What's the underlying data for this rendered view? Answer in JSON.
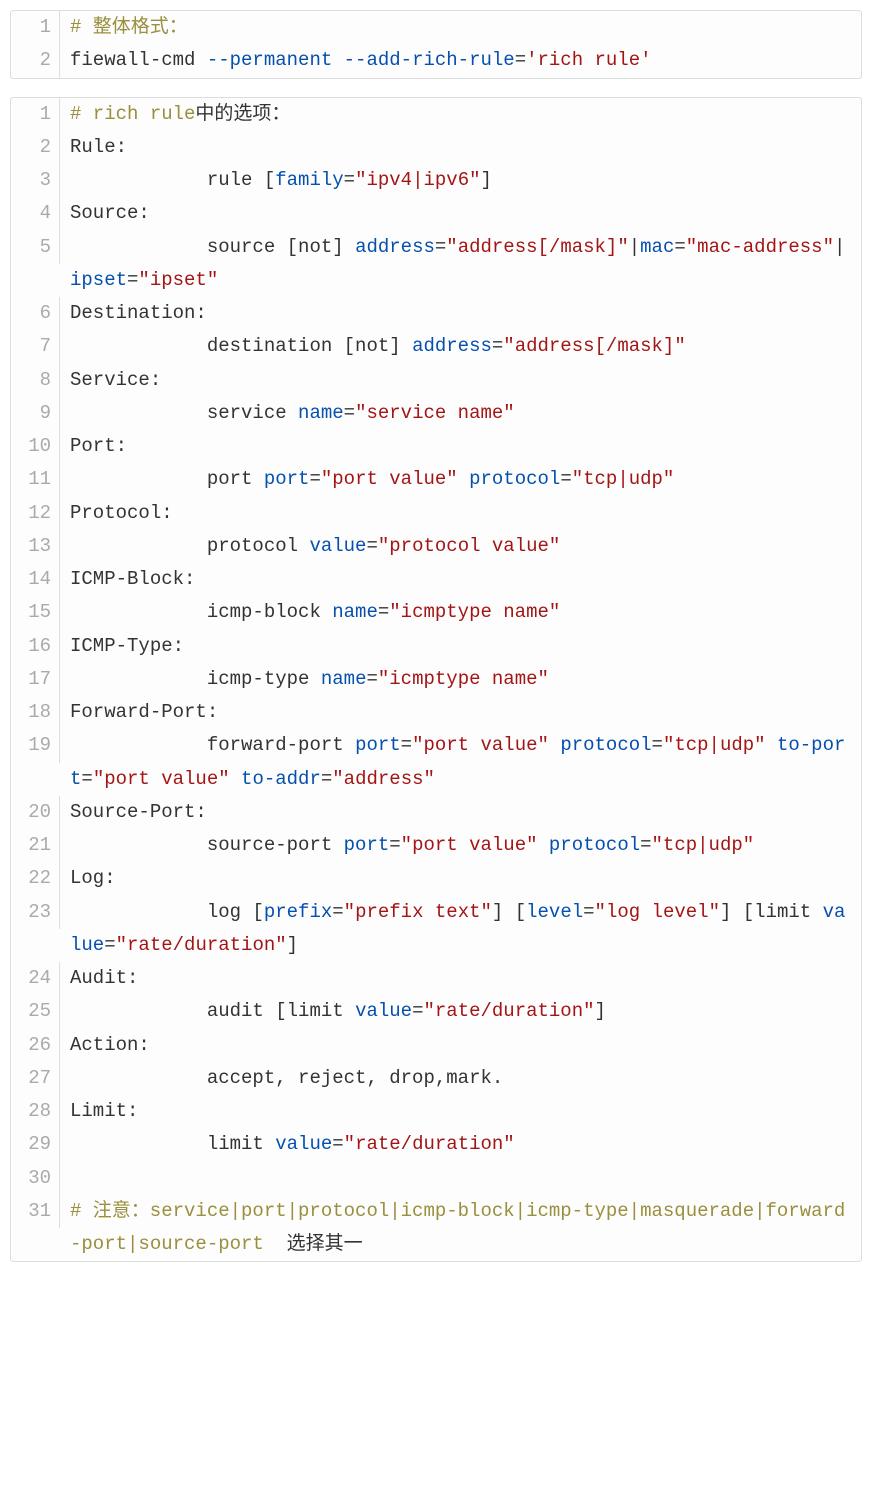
{
  "block1": {
    "lines": [
      {
        "n": "1",
        "seg": [
          {
            "cls": "c",
            "t": "# 整体格式："
          }
        ]
      },
      {
        "n": "2",
        "seg": [
          {
            "cls": "t",
            "t": "fiewall-cmd "
          },
          {
            "cls": "k",
            "t": "--permanent"
          },
          {
            "cls": "t",
            "t": " "
          },
          {
            "cls": "k",
            "t": "--add-rich-rule"
          },
          {
            "cls": "t",
            "t": "="
          },
          {
            "cls": "s",
            "t": "'rich rule'"
          }
        ]
      }
    ]
  },
  "block2": {
    "lines": [
      {
        "n": "1",
        "seg": [
          {
            "cls": "c",
            "t": "# rich rule"
          },
          {
            "cls": "t",
            "t": "中的选项："
          }
        ]
      },
      {
        "n": "2",
        "seg": [
          {
            "cls": "t",
            "t": "Rule:"
          }
        ]
      },
      {
        "n": "3",
        "seg": [
          {
            "cls": "t",
            "t": "            rule ["
          },
          {
            "cls": "k",
            "t": "family"
          },
          {
            "cls": "t",
            "t": "="
          },
          {
            "cls": "s",
            "t": "\"ipv4|ipv6\""
          },
          {
            "cls": "t",
            "t": "]"
          }
        ]
      },
      {
        "n": "4",
        "seg": [
          {
            "cls": "t",
            "t": "Source:"
          }
        ]
      },
      {
        "n": "5",
        "seg": [
          {
            "cls": "t",
            "t": "            source [not] "
          },
          {
            "cls": "k",
            "t": "address"
          },
          {
            "cls": "t",
            "t": "="
          },
          {
            "cls": "s",
            "t": "\"address[/mask]\""
          },
          {
            "cls": "t",
            "t": "|"
          },
          {
            "cls": "k",
            "t": "mac"
          },
          {
            "cls": "t",
            "t": "="
          },
          {
            "cls": "s",
            "t": "\"mac-address\""
          },
          {
            "cls": "t",
            "t": "|"
          },
          {
            "cls": "k",
            "t": "ipset"
          },
          {
            "cls": "t",
            "t": "="
          },
          {
            "cls": "s",
            "t": "\"ipset\""
          }
        ]
      },
      {
        "n": "6",
        "seg": [
          {
            "cls": "t",
            "t": "Destination:"
          }
        ]
      },
      {
        "n": "7",
        "seg": [
          {
            "cls": "t",
            "t": "            destination [not] "
          },
          {
            "cls": "k",
            "t": "address"
          },
          {
            "cls": "t",
            "t": "="
          },
          {
            "cls": "s",
            "t": "\"address[/mask]\""
          }
        ]
      },
      {
        "n": "8",
        "seg": [
          {
            "cls": "t",
            "t": "Service:"
          }
        ]
      },
      {
        "n": "9",
        "seg": [
          {
            "cls": "t",
            "t": "            service "
          },
          {
            "cls": "k",
            "t": "name"
          },
          {
            "cls": "t",
            "t": "="
          },
          {
            "cls": "s",
            "t": "\"service name\""
          }
        ]
      },
      {
        "n": "10",
        "seg": [
          {
            "cls": "t",
            "t": "Port:"
          }
        ]
      },
      {
        "n": "11",
        "seg": [
          {
            "cls": "t",
            "t": "            port "
          },
          {
            "cls": "k",
            "t": "port"
          },
          {
            "cls": "t",
            "t": "="
          },
          {
            "cls": "s",
            "t": "\"port value\""
          },
          {
            "cls": "t",
            "t": " "
          },
          {
            "cls": "k",
            "t": "protocol"
          },
          {
            "cls": "t",
            "t": "="
          },
          {
            "cls": "s",
            "t": "\"tcp|udp\""
          }
        ]
      },
      {
        "n": "12",
        "seg": [
          {
            "cls": "t",
            "t": "Protocol:"
          }
        ]
      },
      {
        "n": "13",
        "seg": [
          {
            "cls": "t",
            "t": "            protocol "
          },
          {
            "cls": "k",
            "t": "value"
          },
          {
            "cls": "t",
            "t": "="
          },
          {
            "cls": "s",
            "t": "\"protocol value\""
          }
        ]
      },
      {
        "n": "14",
        "seg": [
          {
            "cls": "t",
            "t": "ICMP-Block:"
          }
        ]
      },
      {
        "n": "15",
        "seg": [
          {
            "cls": "t",
            "t": "            icmp-block "
          },
          {
            "cls": "k",
            "t": "name"
          },
          {
            "cls": "t",
            "t": "="
          },
          {
            "cls": "s",
            "t": "\"icmptype name\""
          }
        ]
      },
      {
        "n": "16",
        "seg": [
          {
            "cls": "t",
            "t": "ICMP-Type:"
          }
        ]
      },
      {
        "n": "17",
        "seg": [
          {
            "cls": "t",
            "t": "            icmp-type "
          },
          {
            "cls": "k",
            "t": "name"
          },
          {
            "cls": "t",
            "t": "="
          },
          {
            "cls": "s",
            "t": "\"icmptype name\""
          }
        ]
      },
      {
        "n": "18",
        "seg": [
          {
            "cls": "t",
            "t": "Forward-Port:"
          }
        ]
      },
      {
        "n": "19",
        "seg": [
          {
            "cls": "t",
            "t": "            forward-port "
          },
          {
            "cls": "k",
            "t": "port"
          },
          {
            "cls": "t",
            "t": "="
          },
          {
            "cls": "s",
            "t": "\"port value\""
          },
          {
            "cls": "t",
            "t": " "
          },
          {
            "cls": "k",
            "t": "protocol"
          },
          {
            "cls": "t",
            "t": "="
          },
          {
            "cls": "s",
            "t": "\"tcp|udp\""
          },
          {
            "cls": "t",
            "t": " "
          },
          {
            "cls": "k",
            "t": "to-port"
          },
          {
            "cls": "t",
            "t": "="
          },
          {
            "cls": "s",
            "t": "\"port value\""
          },
          {
            "cls": "t",
            "t": " "
          },
          {
            "cls": "k",
            "t": "to-addr"
          },
          {
            "cls": "t",
            "t": "="
          },
          {
            "cls": "s",
            "t": "\"address\""
          }
        ]
      },
      {
        "n": "20",
        "seg": [
          {
            "cls": "t",
            "t": "Source-Port:"
          }
        ]
      },
      {
        "n": "21",
        "seg": [
          {
            "cls": "t",
            "t": "            source-port "
          },
          {
            "cls": "k",
            "t": "port"
          },
          {
            "cls": "t",
            "t": "="
          },
          {
            "cls": "s",
            "t": "\"port value\""
          },
          {
            "cls": "t",
            "t": " "
          },
          {
            "cls": "k",
            "t": "protocol"
          },
          {
            "cls": "t",
            "t": "="
          },
          {
            "cls": "s",
            "t": "\"tcp|udp\""
          }
        ]
      },
      {
        "n": "22",
        "seg": [
          {
            "cls": "t",
            "t": "Log:"
          }
        ]
      },
      {
        "n": "23",
        "seg": [
          {
            "cls": "t",
            "t": "            log ["
          },
          {
            "cls": "k",
            "t": "prefix"
          },
          {
            "cls": "t",
            "t": "="
          },
          {
            "cls": "s",
            "t": "\"prefix text\""
          },
          {
            "cls": "t",
            "t": "] ["
          },
          {
            "cls": "k",
            "t": "level"
          },
          {
            "cls": "t",
            "t": "="
          },
          {
            "cls": "s",
            "t": "\"log level\""
          },
          {
            "cls": "t",
            "t": "] [limit "
          },
          {
            "cls": "k",
            "t": "value"
          },
          {
            "cls": "t",
            "t": "="
          },
          {
            "cls": "s",
            "t": "\"rate/duration\""
          },
          {
            "cls": "t",
            "t": "]"
          }
        ]
      },
      {
        "n": "24",
        "seg": [
          {
            "cls": "t",
            "t": "Audit:"
          }
        ]
      },
      {
        "n": "25",
        "seg": [
          {
            "cls": "t",
            "t": "            audit [limit "
          },
          {
            "cls": "k",
            "t": "value"
          },
          {
            "cls": "t",
            "t": "="
          },
          {
            "cls": "s",
            "t": "\"rate/duration\""
          },
          {
            "cls": "t",
            "t": "]"
          }
        ]
      },
      {
        "n": "26",
        "seg": [
          {
            "cls": "t",
            "t": "Action:"
          }
        ]
      },
      {
        "n": "27",
        "seg": [
          {
            "cls": "t",
            "t": "            accept, reject, drop,mark."
          }
        ]
      },
      {
        "n": "28",
        "seg": [
          {
            "cls": "t",
            "t": "Limit:"
          }
        ]
      },
      {
        "n": "29",
        "seg": [
          {
            "cls": "t",
            "t": "            limit "
          },
          {
            "cls": "k",
            "t": "value"
          },
          {
            "cls": "t",
            "t": "="
          },
          {
            "cls": "s",
            "t": "\"rate/duration\""
          }
        ]
      },
      {
        "n": "30",
        "seg": [
          {
            "cls": "t",
            "t": ""
          }
        ]
      },
      {
        "n": "31",
        "seg": [
          {
            "cls": "c",
            "t": "# 注意：service|port|protocol|icmp-block|icmp-type|masquerade|forward-port|source-port "
          },
          {
            "cls": "t",
            "t": " 选择其一"
          }
        ]
      }
    ]
  }
}
